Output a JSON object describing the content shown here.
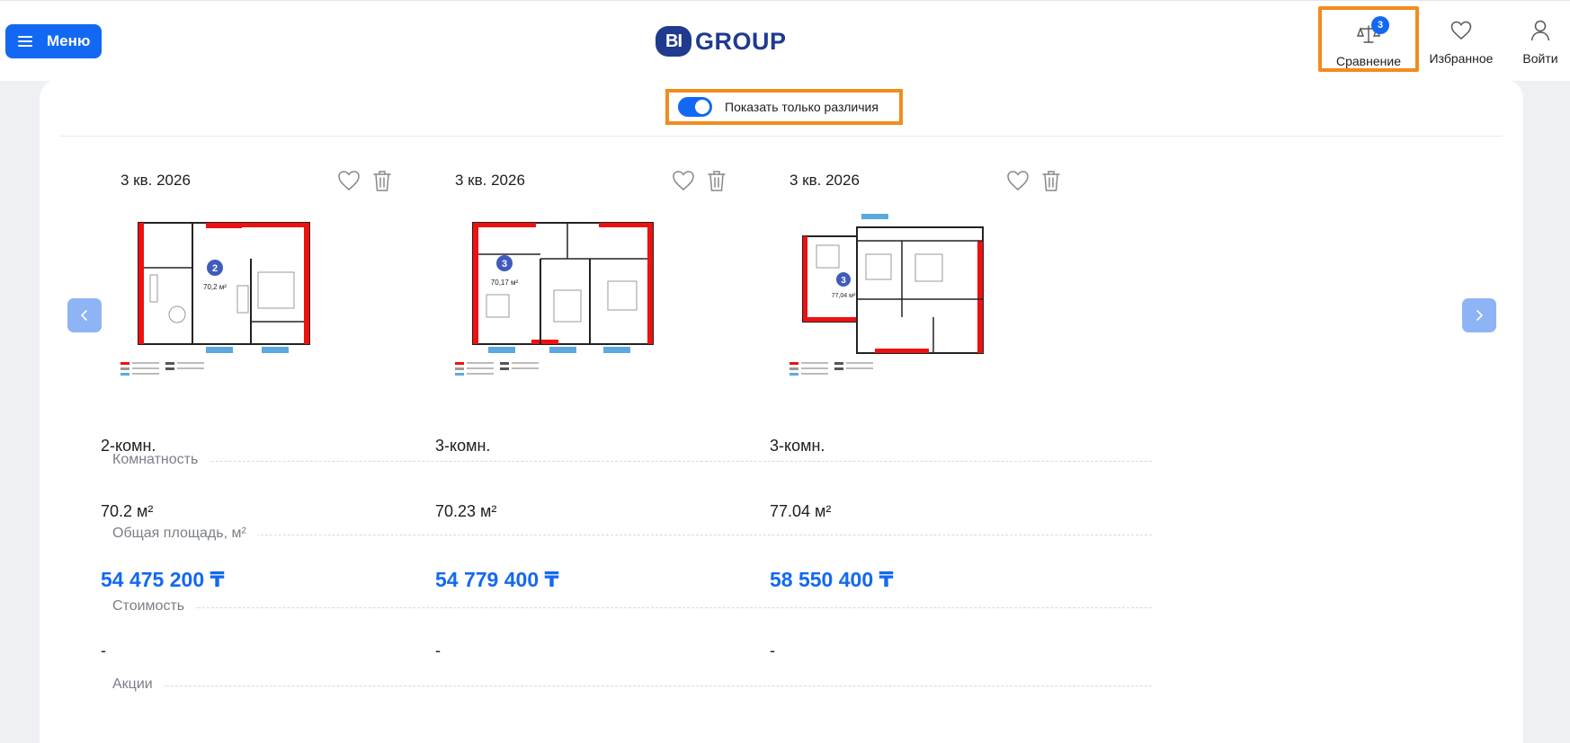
{
  "header": {
    "menu_label": "Меню",
    "logo_mark": "BI",
    "logo_text": "GROUP",
    "compare_label": "Сравнение",
    "compare_count": "3",
    "favorites_label": "Избранное",
    "login_label": "Войти"
  },
  "toolbar": {
    "toggle_label": "Показать только различия",
    "toggle_on": true
  },
  "colors": {
    "accent": "#1268f3",
    "highlight": "#f28c1e",
    "brand": "#1f3a8f"
  },
  "rows": {
    "rooms_label": "Комнатность",
    "area_label": "Общая площадь, м²",
    "price_label": "Стоимость",
    "promo_label": "Акции"
  },
  "apartments": [
    {
      "date": "3 кв. 2026",
      "rooms": "2-комн.",
      "area": "70.2 м²",
      "price": "54 475 200 ₸",
      "promo": "-",
      "plan_number": "2",
      "plan_area": "70,2 м²"
    },
    {
      "date": "3 кв. 2026",
      "rooms": "3-комн.",
      "area": "70.23 м²",
      "price": "54 779 400 ₸",
      "promo": "-",
      "plan_number": "3",
      "plan_area": "70,17 м²"
    },
    {
      "date": "3 кв. 2026",
      "rooms": "3-комн.",
      "area": "77.04 м²",
      "price": "58 550 400 ₸",
      "promo": "-",
      "plan_number": "3",
      "plan_area": "77,04 м²"
    }
  ],
  "icons": {
    "menu": "burger-icon",
    "compare": "scales-icon",
    "favorites": "heart-icon",
    "login": "user-icon",
    "prev": "chevron-left-icon",
    "next": "chevron-right-icon",
    "delete": "trash-icon"
  }
}
